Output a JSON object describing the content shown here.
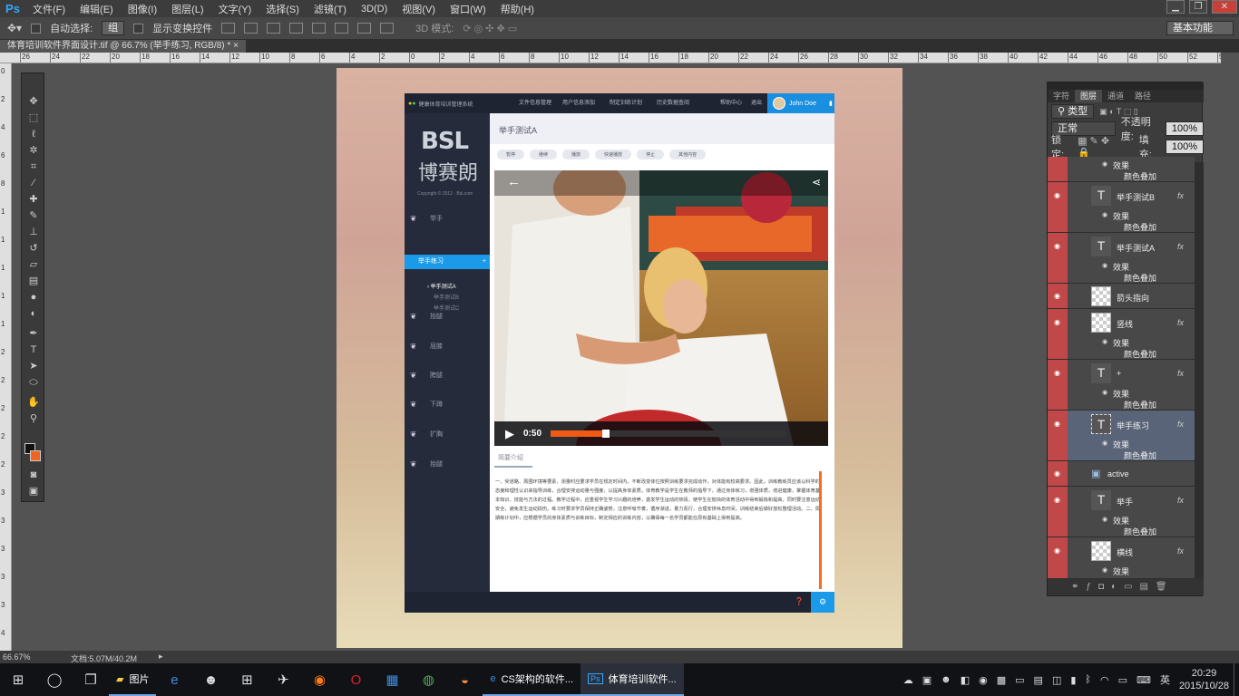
{
  "menubar": {
    "logo": "Ps",
    "items": [
      "文件(F)",
      "编辑(E)",
      "图像(I)",
      "图层(L)",
      "文字(Y)",
      "选择(S)",
      "滤镜(T)",
      "3D(D)",
      "视图(V)",
      "窗口(W)",
      "帮助(H)"
    ]
  },
  "options": {
    "auto_select_label": "自动选择:",
    "auto_select_value": "组",
    "transform_label": "显示变换控件",
    "mode3d_label": "3D 模式:",
    "workspace": "基本功能"
  },
  "doc_tab": "体育培训软件界面设计.tif @ 66.7% (举手练习, RGB/8) * ×",
  "ruler_h": [
    "26",
    "24",
    "22",
    "20",
    "18",
    "16",
    "14",
    "12",
    "10",
    "8",
    "6",
    "4",
    "2",
    "0",
    "2",
    "4",
    "6",
    "8",
    "10",
    "12",
    "14",
    "16",
    "18",
    "20",
    "22",
    "24",
    "26",
    "28",
    "30",
    "32",
    "34",
    "36",
    "38",
    "40",
    "42",
    "44",
    "46",
    "48",
    "50",
    "52",
    "54"
  ],
  "ruler_v": [
    "0",
    "2",
    "4",
    "6",
    "8",
    "1",
    "1",
    "1",
    "1",
    "1",
    "2",
    "2",
    "2",
    "2",
    "2",
    "3",
    "3",
    "3",
    "3",
    "3",
    "4"
  ],
  "mockup": {
    "brand_small": "健康体育培训管理系统",
    "nav": [
      "文件信息管理",
      "用户信息添加",
      "制定训练计划",
      "历史数据查阅"
    ],
    "help": "帮助中心",
    "logout": "退出",
    "user": "John Doe",
    "logo_bsl": "BSL",
    "logo_cn": "博赛朗",
    "copyright": "Copyright © 2012 · Bsl.com",
    "side_first": "举手",
    "side_active": "举手练习",
    "side_active_plus": "+",
    "sub_items": [
      "举手测试A",
      "举手测试B",
      "举手测试C"
    ],
    "side_items": [
      "抬腿",
      "屈膝",
      "胯腿",
      "下蹲",
      "扩胸",
      "抬腿"
    ],
    "title": "举手测试A",
    "buttons": [
      "暂停",
      "继续",
      "播放",
      "快速播放",
      "停止",
      "其他内容"
    ],
    "time": "0:50",
    "progress": 0.22,
    "intro_tab": "简要介绍",
    "intro_text": "一、受道路、周围环境等要素，测量时应要求学员在规定时间内，不断改变体位按照训练要求完成动作，对体能有较高要求。因此，训练教练员应该以科学的态度和理性认识来指导训练，合理安排运动量与强度，以提高身体素质。体育教学是学生在教师的指导下，通过身体练习，增强体质，增进健康，掌握体育基本知识、技能与方法的过程。教学过程中，应重视学生学习兴趣的培养，激发学生运动的热情，使学生在愉快的体育活动中得到锻炼和提高，同时要注意运动安全，避免发生运动损伤。练习时要求学员保持正确姿势，注意呼吸节奏，循序渐进，量力而行，合理安排休息时间，训练结束后做好放松整理活动。二、周期练计划中，应根据学员的身体素质与训练目标，制定相应的训练内容，以确保每一名学员都能在原有基础上得到提高。"
  },
  "panel": {
    "tabs": [
      "字符",
      "图层",
      "通道",
      "路径"
    ],
    "kind": "类型",
    "blend": "正常",
    "opacity_label": "不透明度:",
    "opacity": "100%",
    "lock_label": "锁定:",
    "fill_label": "填充:",
    "fill": "100%",
    "effect": "效果",
    "color_overlay": "颜色叠加",
    "layers": [
      "举手测试B",
      "举手测试A",
      "箭头指向",
      "竖线",
      "+",
      "举手练习",
      "active",
      "举手",
      "横线"
    ]
  },
  "status": {
    "zoom": "66.67%",
    "doc": "文档:5.07M/40.2M"
  },
  "taskbar": {
    "folder": "图片",
    "cs_app": "CS架构的软件...",
    "ps_app": "体育培训软件...",
    "ime": "英",
    "time": "20:29",
    "date": "2015/10/28"
  }
}
